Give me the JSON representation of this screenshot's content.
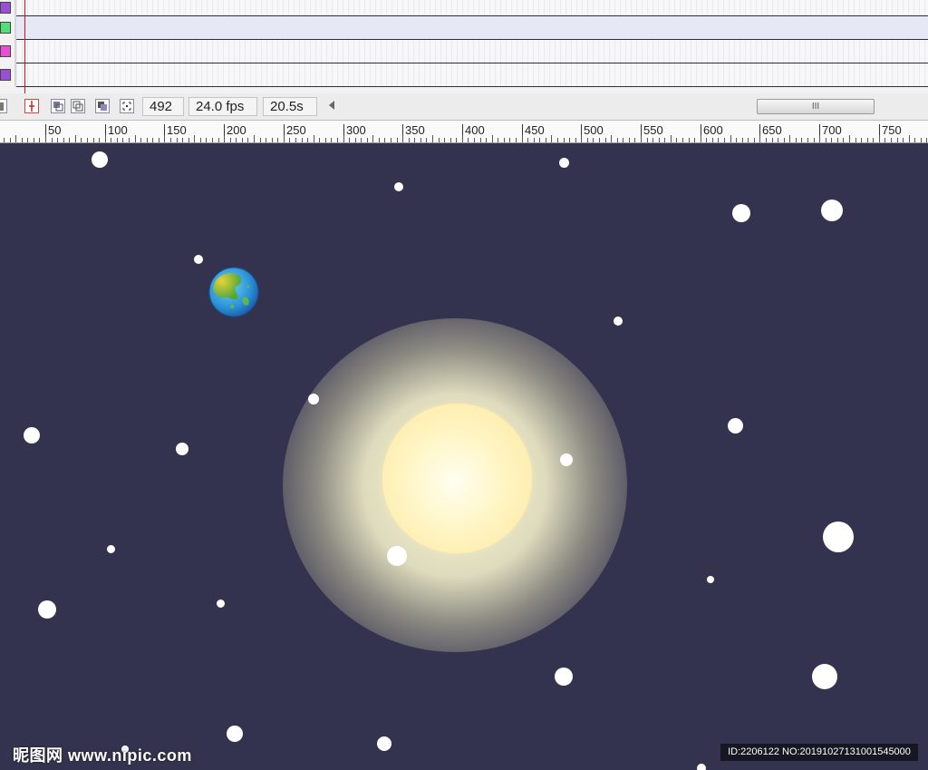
{
  "timeline": {
    "layers": [
      {
        "color": "#9b4fd6",
        "selected": false
      },
      {
        "color": "#4fe07a",
        "selected": true
      },
      {
        "color": "#e84fd2",
        "selected": false
      },
      {
        "color": "#9b4fd6",
        "selected": false
      }
    ]
  },
  "statusbar": {
    "current_frame": "492",
    "frame_rate": "24.0 fps",
    "elapsed_time": "20.5s",
    "scroll_thumb_grip": "III"
  },
  "ruler": {
    "labels": [
      "50",
      "100",
      "150",
      "200",
      "250",
      "300",
      "350",
      "400",
      "450",
      "500",
      "550",
      "600",
      "650",
      "700",
      "750"
    ]
  },
  "stage": {
    "background": "#34334f",
    "sun_color": "#fff5c4",
    "earth_icon": "earth-globe-icon"
  },
  "watermark": {
    "logo": "昵图网 www.nipic.com",
    "id_text": "ID:2206122 NO:20191027131001545000"
  }
}
